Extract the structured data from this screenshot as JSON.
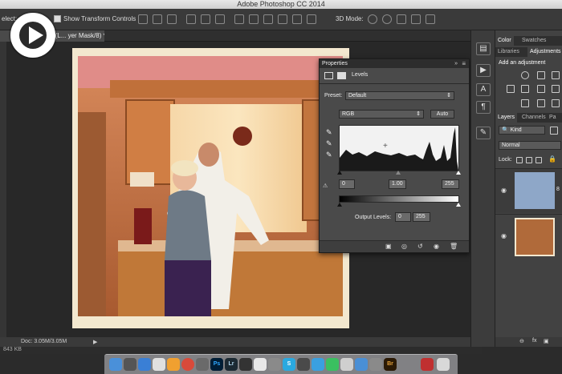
{
  "window": {
    "title": "Adobe Photoshop CC 2014"
  },
  "options_bar": {
    "select_label": "elect:",
    "show_transform_label": "Show Transform Controls",
    "mode_3d_label": "3D Mode:"
  },
  "document": {
    "tab_label": "@ 50% (L... yer Mask/8) *"
  },
  "status_bar": {
    "doc_size": "Doc: 3.05M/3.05M",
    "file_size": "843 KB"
  },
  "properties_panel": {
    "title": "Properties",
    "adjustment_name": "Levels",
    "preset_label": "Preset:",
    "preset_value": "Default",
    "channel_value": "RGB",
    "auto_label": "Auto",
    "input_black": "0",
    "input_gamma": "1.00",
    "input_white": "255",
    "output_label": "Output Levels:",
    "output_black": "0",
    "output_white": "255"
  },
  "right_panels": {
    "tabs_top": [
      "Color",
      "Swatches"
    ],
    "tabs_second": [
      "Libraries",
      "Adjustments"
    ],
    "add_adjustment_label": "Add an adjustment",
    "tabs_layers": [
      "Layers",
      "Channels",
      "Pa"
    ],
    "kind_label": "Kind",
    "blend_mode": "Normal",
    "lock_label": "Lock:"
  },
  "colors": {
    "accent": "#2a2a2a",
    "panel_bg": "#424242",
    "layer_selected": "#5a7fa5"
  },
  "icons": {
    "play": "play-icon",
    "eyedropper": "eyedropper-icon",
    "eye": "eye-icon",
    "trash": "trash-icon",
    "lock": "lock-icon"
  }
}
